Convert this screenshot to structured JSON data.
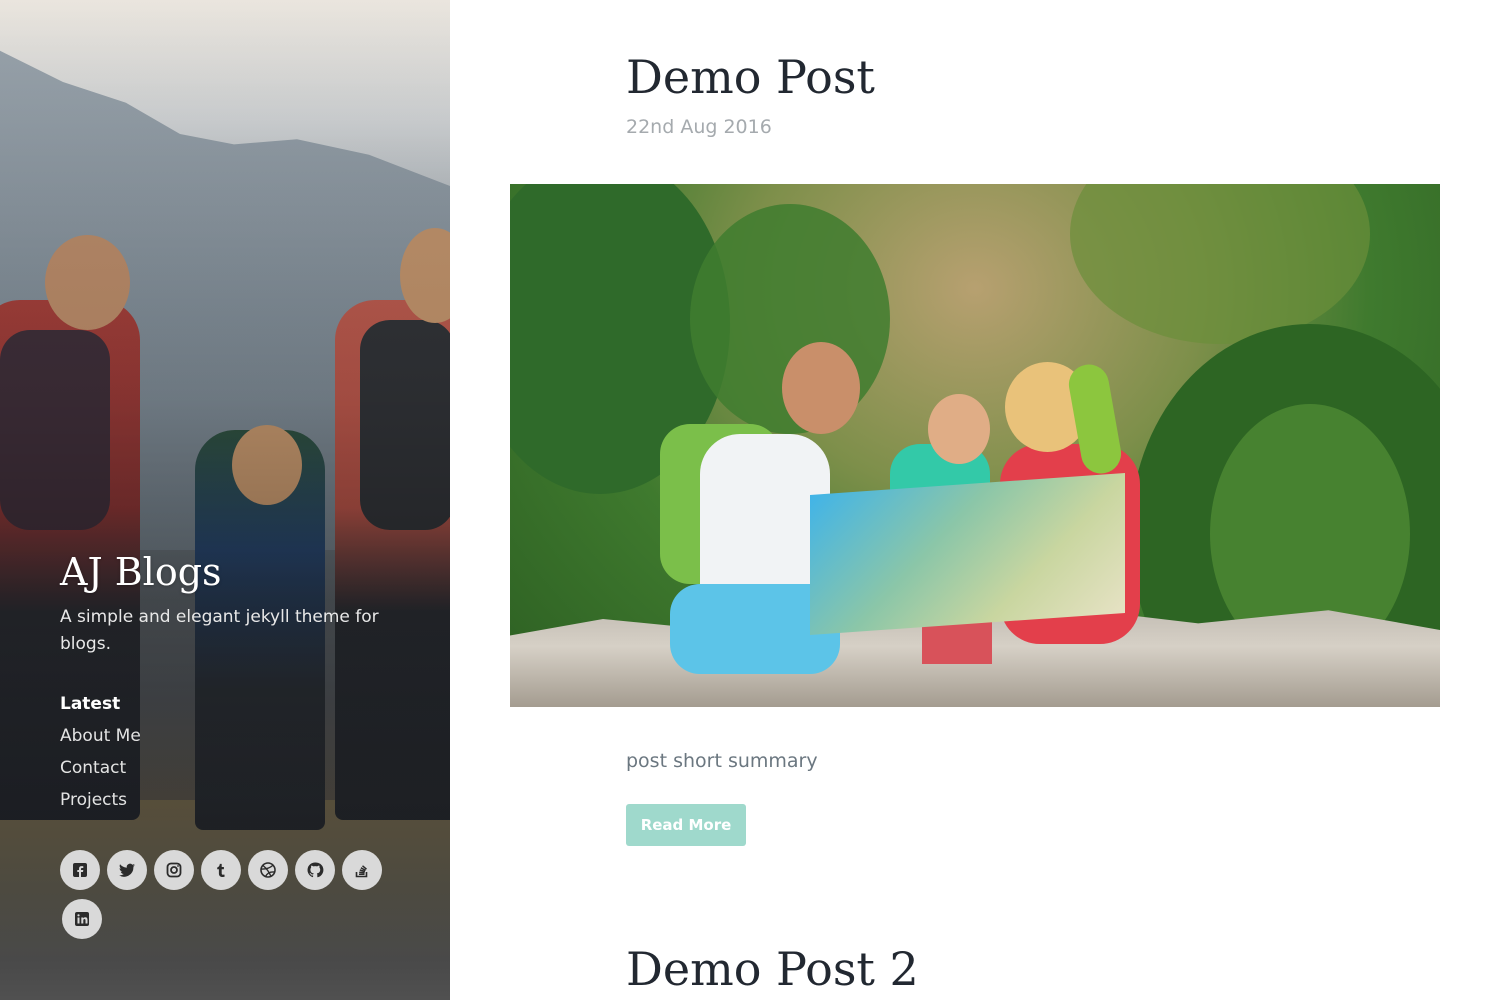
{
  "sidebar": {
    "brand": "AJ Blogs",
    "tagline": "A simple and elegant jekyll theme for blogs.",
    "nav": [
      {
        "label": "Latest",
        "active": true
      },
      {
        "label": "About Me",
        "active": false
      },
      {
        "label": "Contact",
        "active": false
      },
      {
        "label": "Projects",
        "active": false
      }
    ],
    "social": [
      {
        "icon": "facebook-icon"
      },
      {
        "icon": "twitter-icon"
      },
      {
        "icon": "instagram-icon"
      },
      {
        "icon": "tumblr-icon"
      },
      {
        "icon": "dribbble-icon"
      },
      {
        "icon": "github-icon"
      },
      {
        "icon": "stackoverflow-icon"
      },
      {
        "icon": "linkedin-icon"
      }
    ]
  },
  "posts": [
    {
      "title": "Demo Post",
      "date": "22nd Aug 2016",
      "summary": "post short summary",
      "read_more_label": "Read More"
    },
    {
      "title": "Demo Post 2"
    }
  ],
  "colors": {
    "accent": "#9fd9cc",
    "title_text": "#222831",
    "muted_text": "#a5aaae"
  }
}
